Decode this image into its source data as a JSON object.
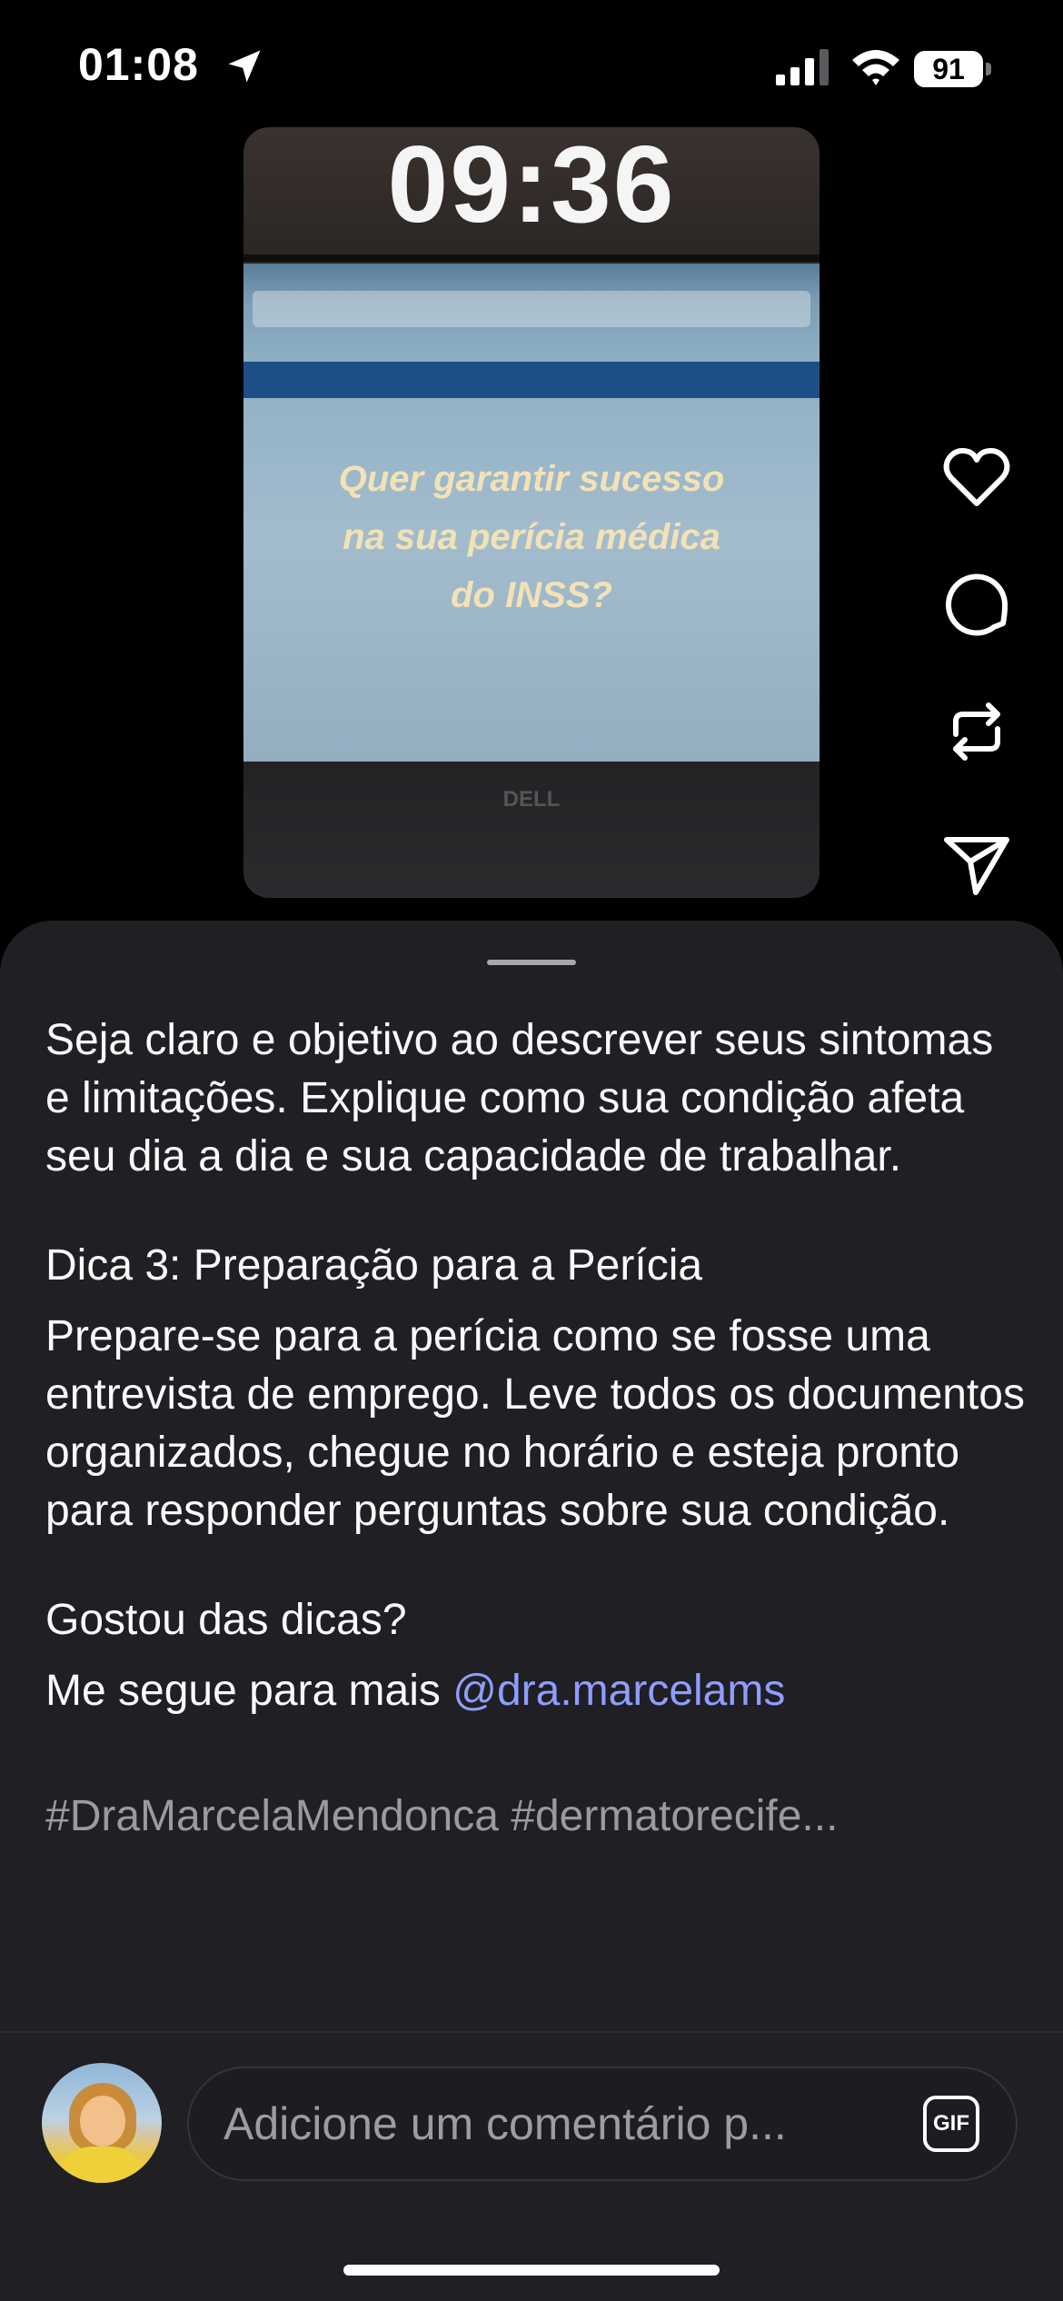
{
  "status_bar": {
    "time": "01:08",
    "battery": "91"
  },
  "video": {
    "clock_overlay": "09:36",
    "overlay_text": [
      "Quer garantir sucesso",
      "na sua perícia médica",
      "do INSS?"
    ],
    "brand": "DELL"
  },
  "actions": {
    "like": "heart-icon",
    "comment": "comment-icon",
    "repost": "repost-icon",
    "share": "send-icon"
  },
  "caption": {
    "paragraph1": "Seja claro e objetivo ao descrever seus sintomas e limitações. Explique como sua condição afeta seu dia a dia e sua capacidade de trabalhar.",
    "tip3_title": "Dica 3: Preparação para a Perícia",
    "tip3_body": "Prepare-se para a perícia como se fosse uma entrevista de emprego. Leve todos os documentos organizados, chegue no horário e esteja pronto para responder perguntas sobre sua condição.",
    "closing_question": "Gostou das dicas?",
    "follow_prefix": "Me segue para mais ",
    "mention": "@dra.marcelams",
    "hashtags": "#DraMarcelaMendonca #dermatorecife..."
  },
  "comment": {
    "placeholder": "Adicione um comentário p...",
    "gif_label": "GIF"
  },
  "colors": {
    "sheet_bg": "#1f1f24",
    "mention": "#8f9eff",
    "background": "#000000"
  }
}
